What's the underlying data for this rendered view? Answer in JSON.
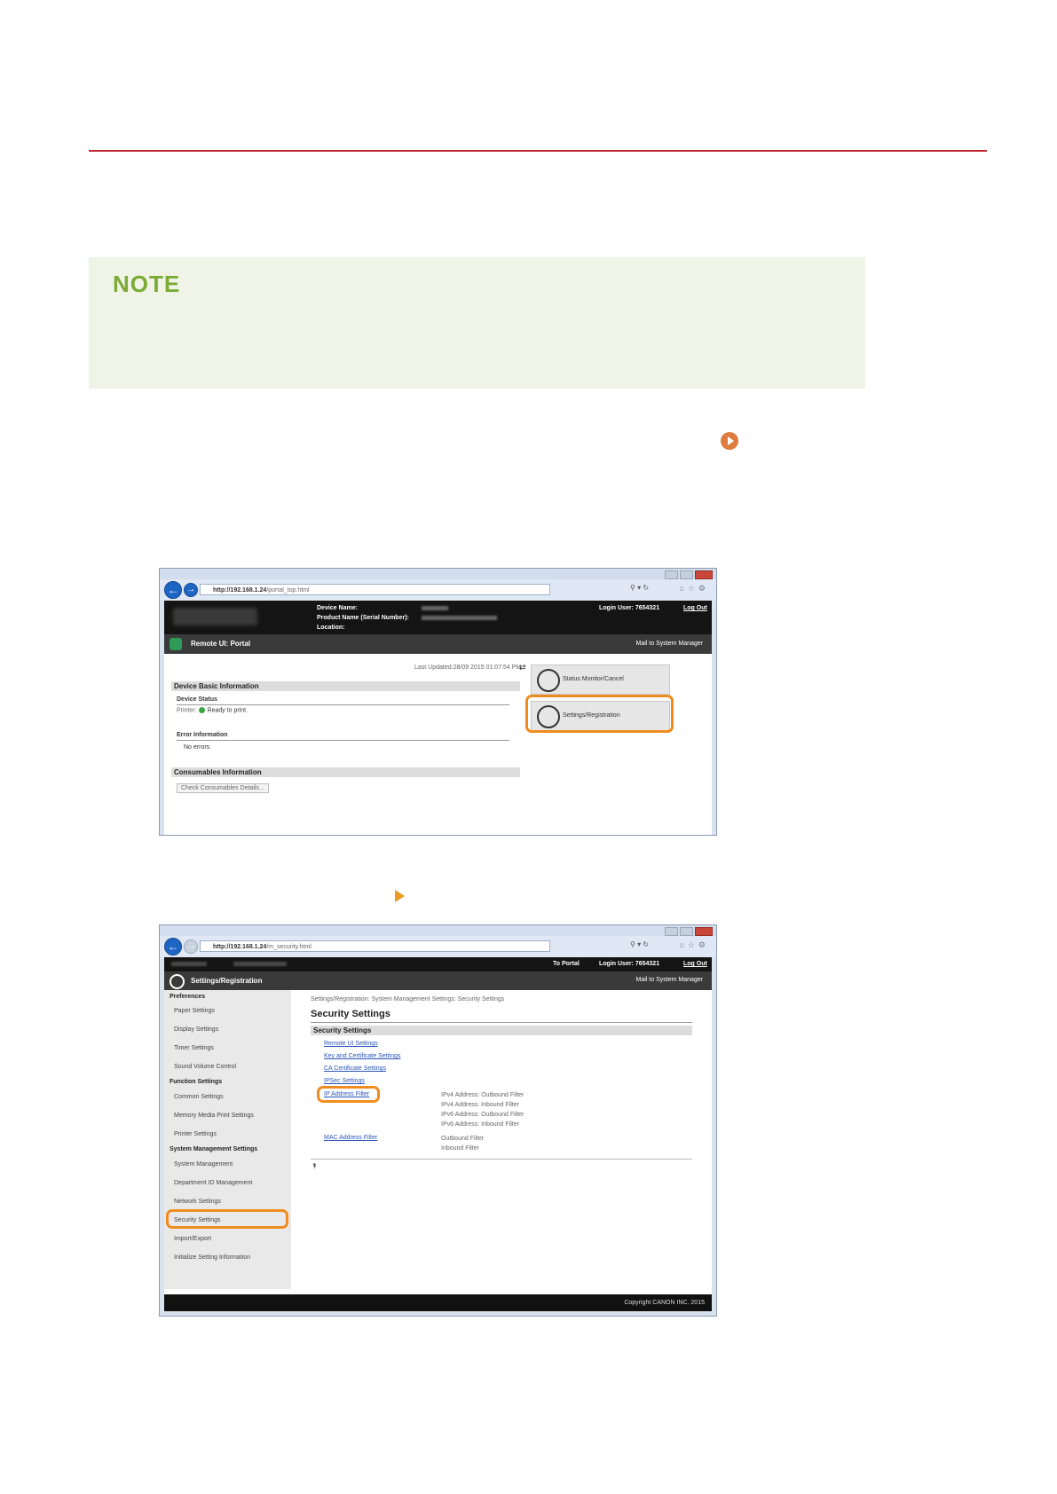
{
  "note": {
    "title": "NOTE"
  },
  "screen1": {
    "url_host": "http://192.168.1.24",
    "url_path": "/portal_top.html",
    "device_name_label": "Device Name:",
    "product_name_label": "Product Name (Serial Number):",
    "location_label": "Location:",
    "login_user_label": "Login User:",
    "login_user_value": "7654321",
    "logout": "Log Out",
    "portal_title": "Remote UI: Portal",
    "mail_link": "Mail to System Manager",
    "last_updated": "Last Updated:28/09 2015 01:07:54 PM",
    "device_basic_info": "Device Basic Information",
    "device_status": "Device Status",
    "printer_label": "Printer:",
    "printer_status": "Ready to print.",
    "error_info": "Error Information",
    "no_errors": "No errors.",
    "consumables_info": "Consumables Information",
    "check_consumables": "Check Consumables Details...",
    "status_monitor_button": "Status Monitor/Cancel",
    "settings_button": "Settings/Registration"
  },
  "screen2": {
    "url_host": "http://192.168.1.24",
    "url_path": "/m_security.html",
    "to_portal": "To Portal",
    "login_user_label": "Login User:",
    "login_user_value": "7654321",
    "logout": "Log Out",
    "header_title": "Settings/Registration",
    "mail_link": "Mail to System Manager",
    "breadcrumb": "Settings/Registration: System Management Settings: Security Settings",
    "page_title": "Security Settings",
    "section_title": "Security Settings",
    "sidebar": {
      "preferences": "Preferences",
      "paper_settings": "Paper Settings",
      "display_settings": "Display Settings",
      "timer_settings": "Timer Settings",
      "sound_volume_control": "Sound Volume Control",
      "function_settings": "Function Settings",
      "common_settings": "Common Settings",
      "memory_media_print": "Memory Media Print Settings",
      "printer_settings": "Printer Settings",
      "system_management_settings": "System Management Settings",
      "system_management": "System Management",
      "department_id": "Department ID Management",
      "network_settings": "Network Settings",
      "security_settings": "Security Settings",
      "import_export": "Import/Export",
      "initialize": "Initialize Setting Information"
    },
    "links": {
      "remote_ui": "Remote UI Settings",
      "key_cert": "Key and Certificate Settings",
      "ca_cert": "CA Certificate Settings",
      "ipsec": "IPSec Settings",
      "ip_filter": "IP Address Filter",
      "mac_filter": "MAC Address Filter"
    },
    "ip_filter_items": {
      "a": "IPv4 Address: Outbound Filter",
      "b": "IPv4 Address: Inbound Filter",
      "c": "IPv6 Address: Outbound Filter",
      "d": "IPv6 Address: Inbound Filter"
    },
    "mac_filter_items": {
      "a": "Outbound Filter",
      "b": "Inbound Filter"
    },
    "copyright": "Copyright CANON INC. 2015"
  },
  "colors": {
    "accent_rule": "#c0272d",
    "note_title": "#7bab36",
    "note_bg": "#f0f4e6",
    "highlight": "#f08c1e"
  }
}
